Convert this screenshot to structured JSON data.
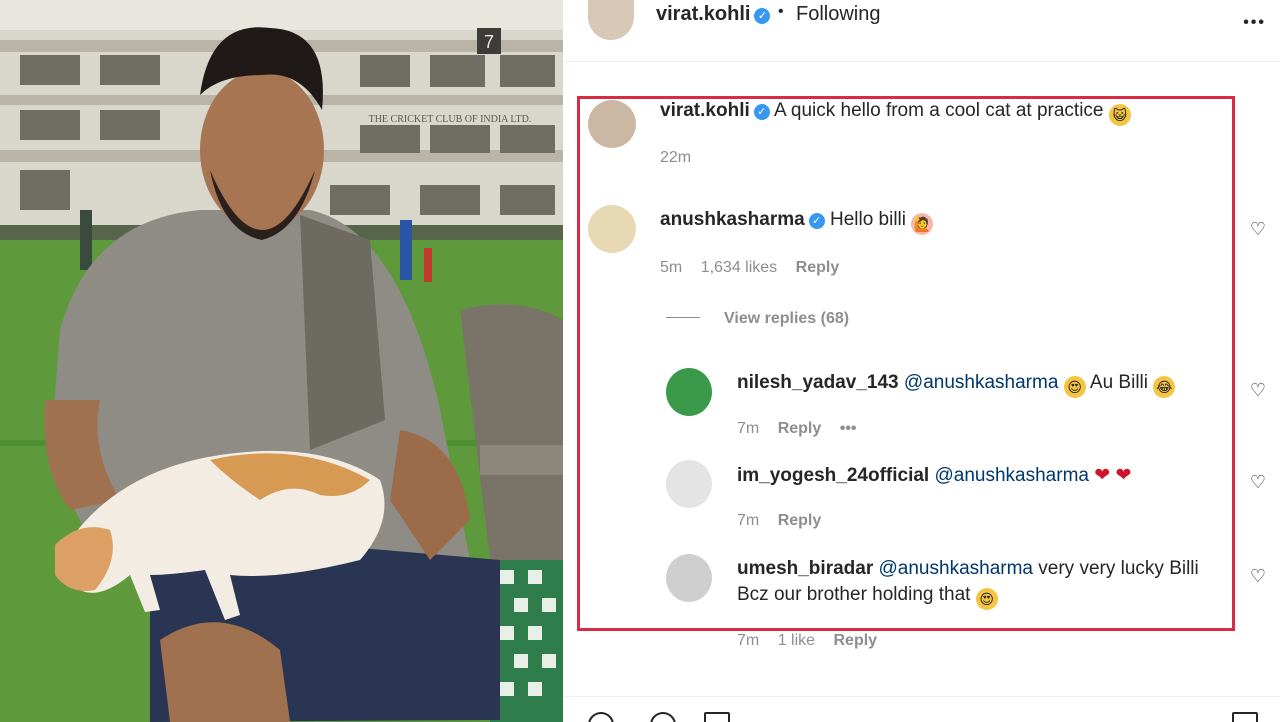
{
  "post": {
    "author": "virat.kohli",
    "follow_status": "Following",
    "separator": "•"
  },
  "caption": {
    "user": "virat.kohli",
    "text": "A quick hello from a cool cat at practice",
    "time": "22m"
  },
  "comments": [
    {
      "user": "anushkasharma",
      "text": "Hello billi",
      "time": "5m",
      "likes": "1,634 likes",
      "reply": "Reply",
      "view_replies": "View replies (68)"
    }
  ],
  "replies": [
    {
      "user": "nilesh_yadav_143",
      "mention": "@anushkasharma",
      "text": "Au Billi",
      "time": "7m",
      "reply": "Reply",
      "more": "•••"
    },
    {
      "user": "im_yogesh_24official",
      "mention": "@anushkasharma",
      "text": "",
      "time": "7m",
      "reply": "Reply"
    },
    {
      "user": "umesh_biradar",
      "mention": "@anushkasharma",
      "text_line1": "very very lucky Billi",
      "text_line2": "Bcz our brother holding that",
      "time": "7m",
      "likes": "1 like",
      "reply": "Reply"
    }
  ],
  "photo_sign": "THE CRICKET CLUB OF INDIA LTD.",
  "photo_number": "7",
  "colors": {
    "highlight": "#d92b43",
    "verified": "#3897f0",
    "mention": "#00376b",
    "muted": "#8e8e8e"
  },
  "icons": [
    "verified-icon",
    "more-icon",
    "heart-icon",
    "emoji-icon"
  ]
}
